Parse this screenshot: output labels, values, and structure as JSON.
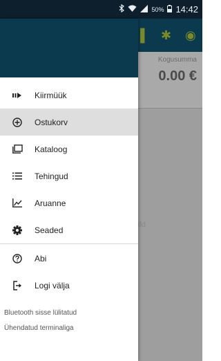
{
  "status_bar": {
    "battery_percent": "50%",
    "time": "14:42",
    "icons": [
      "bluetooth-icon",
      "wifi-icon",
      "signal-icon",
      "battery-icon"
    ]
  },
  "background_app": {
    "total_label": "Kogusumma",
    "total_value": "0.00 €",
    "empty_hint_fragment": "ild"
  },
  "drawer": {
    "primary_items": [
      {
        "label": "Kiirmüük",
        "icon": "quick-sale-icon",
        "selected": false
      },
      {
        "label": "Ostukorv",
        "icon": "add-circle-icon",
        "selected": true
      },
      {
        "label": "Kataloog",
        "icon": "catalog-icon",
        "selected": false
      },
      {
        "label": "Tehingud",
        "icon": "list-icon",
        "selected": false
      },
      {
        "label": "Aruanne",
        "icon": "chart-icon",
        "selected": false
      },
      {
        "label": "Seaded",
        "icon": "gear-icon",
        "selected": false
      }
    ],
    "secondary_items": [
      {
        "label": "Abi",
        "icon": "help-icon"
      },
      {
        "label": "Logi välja",
        "icon": "logout-icon"
      }
    ],
    "status_lines": [
      "Bluetooth sisse lülitatud",
      "Ühendatud terminaliga"
    ]
  },
  "colors": {
    "header": "#0b3a4f",
    "status_bar": "#0d1f2c",
    "selected_item": "#dedede",
    "accent_icon": "#7a8a2a"
  }
}
